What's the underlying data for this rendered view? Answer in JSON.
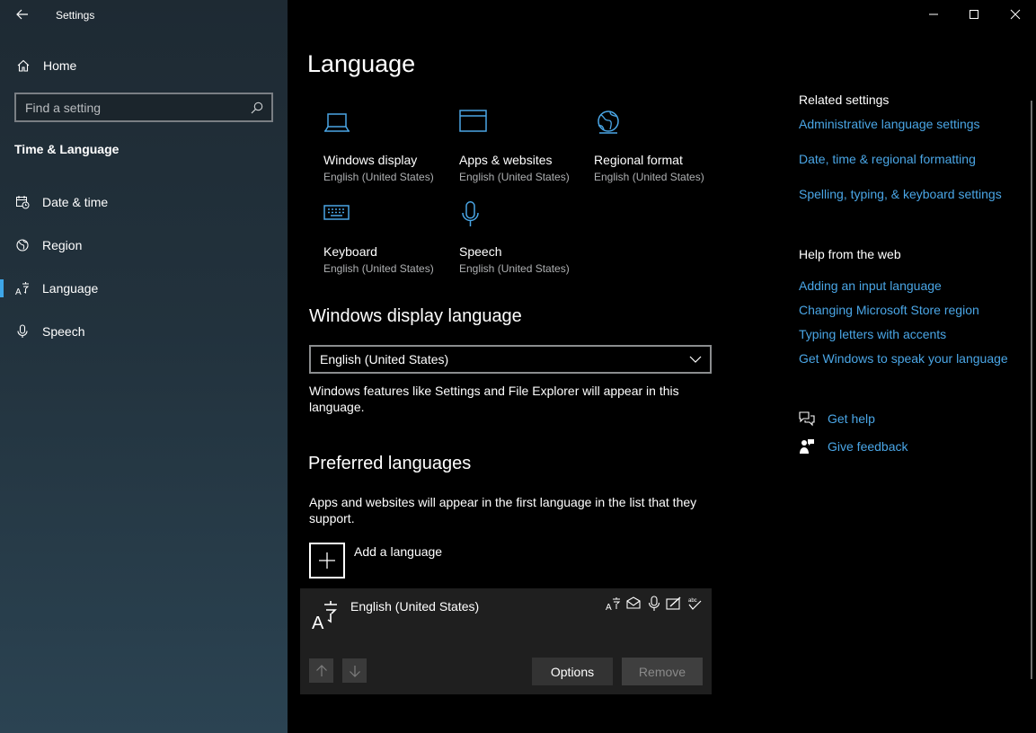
{
  "window": {
    "app_title": "Settings",
    "controls": [
      "minimize",
      "maximize",
      "close"
    ]
  },
  "sidebar": {
    "home_label": "Home",
    "search_placeholder": "Find a setting",
    "section_title": "Time & Language",
    "items": [
      {
        "label": "Date & time",
        "icon": "calendar-clock-icon"
      },
      {
        "label": "Region",
        "icon": "globe-icon"
      },
      {
        "label": "Language",
        "icon": "language-icon",
        "active": true
      },
      {
        "label": "Speech",
        "icon": "microphone-icon"
      }
    ]
  },
  "main": {
    "title": "Language",
    "tiles": [
      {
        "title": "Windows display",
        "subtitle": "English (United States)",
        "icon": "laptop-icon"
      },
      {
        "title": "Apps & websites",
        "subtitle": "English (United States)",
        "icon": "browser-window-icon"
      },
      {
        "title": "Regional format",
        "subtitle": "English (United States)",
        "icon": "globe-icon"
      },
      {
        "title": "Keyboard",
        "subtitle": "English (United States)",
        "icon": "keyboard-icon"
      },
      {
        "title": "Speech",
        "subtitle": "English (United States)",
        "icon": "microphone-icon"
      }
    ],
    "display_language": {
      "heading": "Windows display language",
      "selected": "English (United States)",
      "description": "Windows features like Settings and File Explorer will appear in this language."
    },
    "preferred": {
      "heading": "Preferred languages",
      "description": "Apps and websites will appear in the first language in the list that they support.",
      "add_label": "Add a language",
      "languages": [
        {
          "name": "English (United States)",
          "features": [
            "display-language-icon",
            "text-to-speech-icon",
            "speech-recognition-icon",
            "handwriting-icon",
            "basic-typing-icon"
          ]
        }
      ],
      "options_label": "Options",
      "remove_label": "Remove"
    }
  },
  "related": {
    "heading": "Related settings",
    "links": [
      "Administrative language settings",
      "Date, time & regional formatting",
      "Spelling, typing, & keyboard settings"
    ]
  },
  "help": {
    "heading": "Help from the web",
    "links": [
      "Adding an input language",
      "Changing Microsoft Store region",
      "Typing letters with accents",
      "Get Windows to speak your language"
    ]
  },
  "support": {
    "get_help": "Get help",
    "give_feedback": "Give feedback"
  },
  "colors": {
    "accent": "#4aa6e6",
    "active_indicator": "#3ea6e8"
  }
}
